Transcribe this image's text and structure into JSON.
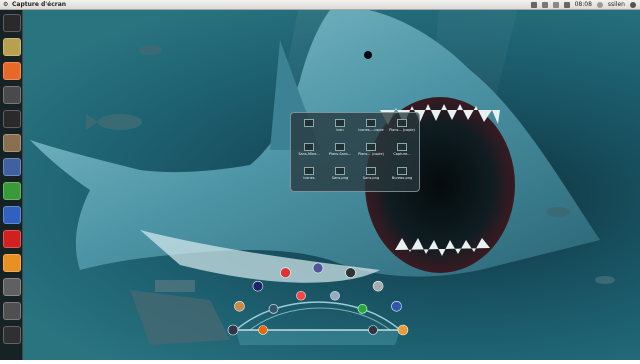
{
  "topbar": {
    "app_title": "Capture d'écran",
    "clock": "08:08",
    "user": "ssilen"
  },
  "launcher": {
    "items": [
      {
        "icon": "ubuntu-icon",
        "color": "#2a2a2a"
      },
      {
        "icon": "files-icon",
        "color": "#b8a050"
      },
      {
        "icon": "ubuntu-software-icon",
        "color": "#e8682a"
      },
      {
        "icon": "terminal-icon",
        "color": "#4a4a4a"
      },
      {
        "icon": "system-icon",
        "color": "#2a2a2a"
      },
      {
        "icon": "folder-icon",
        "color": "#8a7050"
      },
      {
        "icon": "media-icon",
        "color": "#4060a0"
      },
      {
        "icon": "chromium-icon",
        "color": "#3a9a3a"
      },
      {
        "icon": "document-icon",
        "color": "#3060c0"
      },
      {
        "icon": "close-app-icon",
        "color": "#d02020"
      },
      {
        "icon": "vlc-icon",
        "color": "#e89020"
      },
      {
        "icon": "settings-icon",
        "color": "#606060"
      },
      {
        "icon": "info-icon",
        "color": "#505050"
      },
      {
        "icon": "trash-icon",
        "color": "#303030"
      }
    ]
  },
  "window": {
    "cells": [
      {
        "label": ""
      },
      {
        "label": "Icon"
      },
      {
        "label": "icones-...copie"
      },
      {
        "label": "Plans... (copie)"
      },
      {
        "label": "Sans-Mine..."
      },
      {
        "label": "Plans-Sans..."
      },
      {
        "label": "Plans... (copie)"
      },
      {
        "label": "Capture..."
      },
      {
        "label": "icones"
      },
      {
        "label": "Sans.png"
      },
      {
        "label": "Sans.png"
      },
      {
        "label": "Bureau.png"
      }
    ]
  }
}
